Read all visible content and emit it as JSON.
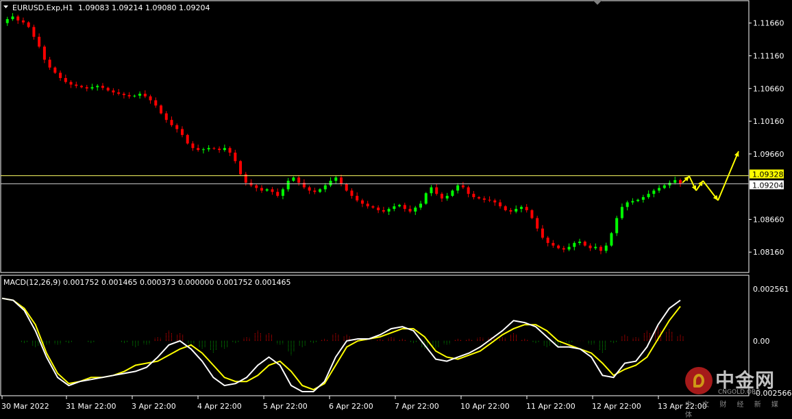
{
  "header": {
    "symbol": "EURUSD.Exp,H1",
    "ohlc": "1.09083 1.09214 1.09080 1.09204"
  },
  "macd_header": "MACD(12,26,9) 0.001752 0.001465 0.000373 0.000000 0.001752 0.001465",
  "price_axis_labels": [
    "1.11660",
    "1.11160",
    "1.10660",
    "1.10160",
    "1.09660",
    "1.08660",
    "1.08160"
  ],
  "price_badges": [
    {
      "label": "1.09328",
      "value": 1.09328,
      "bg": "#ffff00",
      "fg": "#000000"
    },
    {
      "label": "1.09204",
      "value": 1.09204,
      "bg": "#ffffff",
      "fg": "#000000"
    }
  ],
  "macd_axis_labels": [
    "0.002561",
    "0.00",
    "-0.002566"
  ],
  "time_labels": [
    "30 Mar 2022",
    "31 Mar 22:00",
    "3 Apr 22:00",
    "4 Apr 22:00",
    "5 Apr 22:00",
    "6 Apr 22:00",
    "7 Apr 22:00",
    "10 Apr 22:00",
    "11 Apr 22:00",
    "12 Apr 22:00",
    "13 Apr 22:00"
  ],
  "watermark": {
    "cn": "中金网",
    "en": "CNGOLD.ORG",
    "sub": "中 文 财 经 新 媒 体"
  },
  "colors": {
    "bull": "#00ff00",
    "bear": "#ff0000",
    "macd_main": "#ffffff",
    "macd_signal": "#ffff00",
    "hist_pos": "#ff0000",
    "hist_neg": "#00aa00",
    "forecast": "#ffff00",
    "grid_border": "#ffffff"
  },
  "chart_data": {
    "type": "line",
    "price_range": [
      1.0788,
      1.1196
    ],
    "horizontal_lines": [
      1.09328,
      1.09204
    ],
    "price_path": [
      [
        0,
        1.1166
      ],
      [
        4,
        1.1172
      ],
      [
        8,
        1.1176
      ],
      [
        12,
        1.117
      ],
      [
        16,
        1.1167
      ],
      [
        20,
        1.116
      ],
      [
        24,
        1.1145
      ],
      [
        28,
        1.113
      ],
      [
        32,
        1.111
      ],
      [
        36,
        1.1098
      ],
      [
        40,
        1.109
      ],
      [
        44,
        1.1082
      ],
      [
        48,
        1.1076
      ],
      [
        52,
        1.1072
      ],
      [
        56,
        1.107
      ],
      [
        60,
        1.1068
      ],
      [
        64,
        1.1066
      ],
      [
        68,
        1.1068
      ],
      [
        72,
        1.107
      ],
      [
        76,
        1.1067
      ],
      [
        80,
        1.1063
      ],
      [
        84,
        1.106
      ],
      [
        88,
        1.1058
      ],
      [
        92,
        1.1056
      ],
      [
        96,
        1.1054
      ],
      [
        100,
        1.1055
      ],
      [
        104,
        1.1058
      ],
      [
        108,
        1.1054
      ],
      [
        112,
        1.1048
      ],
      [
        116,
        1.104
      ],
      [
        120,
        1.1028
      ],
      [
        124,
        1.1018
      ],
      [
        128,
        1.101
      ],
      [
        132,
        1.1004
      ],
      [
        136,
        1.0995
      ],
      [
        140,
        1.0982
      ],
      [
        144,
        1.0975
      ],
      [
        148,
        1.0972
      ],
      [
        152,
        1.0973
      ],
      [
        156,
        1.0975
      ],
      [
        160,
        1.0974
      ],
      [
        164,
        1.0972
      ],
      [
        168,
        1.0975
      ],
      [
        172,
        1.0968
      ],
      [
        176,
        1.0955
      ],
      [
        180,
        1.0935
      ],
      [
        184,
        1.0922
      ],
      [
        188,
        1.0918
      ],
      [
        192,
        1.0914
      ],
      [
        196,
        1.091
      ],
      [
        200,
        1.0912
      ],
      [
        204,
        1.0908
      ],
      [
        208,
        1.0902
      ],
      [
        212,
        1.0912
      ],
      [
        216,
        1.0925
      ],
      [
        220,
        1.093
      ],
      [
        224,
        1.0922
      ],
      [
        228,
        1.0915
      ],
      [
        232,
        1.091
      ],
      [
        236,
        1.0908
      ],
      [
        240,
        1.0912
      ],
      [
        244,
        1.0918
      ],
      [
        248,
        1.0925
      ],
      [
        252,
        1.093
      ],
      [
        256,
        1.092
      ],
      [
        260,
        1.091
      ],
      [
        264,
        1.0902
      ],
      [
        268,
        1.0895
      ],
      [
        272,
        1.089
      ],
      [
        276,
        1.0886
      ],
      [
        280,
        1.0884
      ],
      [
        284,
        1.088
      ],
      [
        288,
        1.0878
      ],
      [
        292,
        1.0882
      ],
      [
        296,
        1.0886
      ],
      [
        300,
        1.0888
      ],
      [
        304,
        1.0882
      ],
      [
        308,
        1.0878
      ],
      [
        312,
        1.0884
      ],
      [
        316,
        1.089
      ],
      [
        320,
        1.0906
      ],
      [
        324,
        1.0915
      ],
      [
        328,
        1.0905
      ],
      [
        332,
        1.0898
      ],
      [
        336,
        1.0902
      ],
      [
        340,
        1.091
      ],
      [
        344,
        1.0918
      ],
      [
        348,
        1.0915
      ],
      [
        352,
        1.0905
      ],
      [
        356,
        1.09
      ],
      [
        360,
        1.0898
      ],
      [
        364,
        1.0896
      ],
      [
        368,
        1.0895
      ],
      [
        372,
        1.0892
      ],
      [
        376,
        1.0886
      ],
      [
        380,
        1.088
      ],
      [
        384,
        1.0878
      ],
      [
        388,
        1.0882
      ],
      [
        392,
        1.0885
      ],
      [
        396,
        1.088
      ],
      [
        400,
        1.0868
      ],
      [
        404,
        1.0852
      ],
      [
        408,
        1.0838
      ],
      [
        412,
        1.083
      ],
      [
        416,
        1.0826
      ],
      [
        420,
        1.0822
      ],
      [
        424,
        1.082
      ],
      [
        428,
        1.0824
      ],
      [
        432,
        1.083
      ],
      [
        436,
        1.0832
      ],
      [
        440,
        1.0826
      ],
      [
        444,
        1.0822
      ],
      [
        448,
        1.0824
      ],
      [
        452,
        1.0818
      ],
      [
        456,
        1.0826
      ],
      [
        460,
        1.0845
      ],
      [
        464,
        1.0868
      ],
      [
        468,
        1.0885
      ],
      [
        472,
        1.0892
      ],
      [
        476,
        1.0894
      ],
      [
        480,
        1.0896
      ],
      [
        484,
        1.09
      ],
      [
        488,
        1.0905
      ],
      [
        492,
        1.091
      ],
      [
        496,
        1.0914
      ],
      [
        500,
        1.0918
      ],
      [
        504,
        1.0922
      ],
      [
        508,
        1.0926
      ],
      [
        512,
        1.0921
      ]
    ],
    "forecast_path": [
      [
        1.0922,
        1.0932
      ],
      [
        1.0932,
        1.091
      ],
      [
        1.091,
        1.0925
      ],
      [
        1.0925,
        1.0895
      ],
      [
        1.0895,
        1.097
      ]
    ],
    "macd_range": [
      -0.002566,
      0.002561
    ],
    "macd_main": [
      0.0021,
      0.002,
      0.0015,
      0.0005,
      -0.0008,
      -0.0018,
      -0.0022,
      -0.002,
      -0.0019,
      -0.0018,
      -0.0017,
      -0.0016,
      -0.0015,
      -0.0013,
      -0.0008,
      -0.0002,
      0.0,
      -0.0004,
      -0.001,
      -0.0018,
      -0.0022,
      -0.0021,
      -0.0018,
      -0.0012,
      -0.0008,
      -0.0012,
      -0.0022,
      -0.0025,
      -0.0025,
      -0.002,
      -0.0008,
      0.0,
      0.0001,
      0.0001,
      0.0003,
      0.0006,
      0.0007,
      0.0005,
      -0.0002,
      -0.0009,
      -0.001,
      -0.0008,
      -0.0006,
      -0.0003,
      0.0001,
      0.0005,
      0.001,
      0.0009,
      0.0007,
      0.0002,
      -0.0003,
      -0.0003,
      -0.0004,
      -0.0008,
      -0.0017,
      -0.0018,
      -0.0011,
      -0.001,
      -0.0003,
      0.0008,
      0.0016,
      0.002
    ],
    "macd_signal": [
      0.0021,
      0.002,
      0.0016,
      0.0008,
      -0.0006,
      -0.0016,
      -0.0021,
      -0.002,
      -0.0018,
      -0.0018,
      -0.0017,
      -0.0015,
      -0.0012,
      -0.0011,
      -0.001,
      -0.0007,
      -0.0004,
      -0.0002,
      -0.0006,
      -0.0012,
      -0.0018,
      -0.002,
      -0.002,
      -0.0017,
      -0.0012,
      -0.001,
      -0.0015,
      -0.0022,
      -0.0024,
      -0.0021,
      -0.0012,
      -0.0003,
      0.0,
      0.0001,
      0.0002,
      0.0004,
      0.0006,
      0.0006,
      0.0002,
      -0.0005,
      -0.0008,
      -0.0009,
      -0.0007,
      -0.0005,
      -0.0001,
      0.0003,
      0.0006,
      0.0008,
      0.0008,
      0.0005,
      0.0,
      -0.0002,
      -0.0004,
      -0.0006,
      -0.0011,
      -0.0017,
      -0.0014,
      -0.0012,
      -0.0008,
      0.0001,
      0.001,
      0.0017
    ],
    "macd_hist": [
      0.0,
      0.0,
      -0.0001,
      -0.0003,
      -0.0002,
      -0.0002,
      -0.0001,
      0.0,
      -0.0001,
      0.0,
      0.0,
      -0.0001,
      -0.0003,
      -0.0002,
      0.0002,
      0.0005,
      0.0004,
      -0.0002,
      -0.0004,
      -0.0006,
      -0.0004,
      -0.0001,
      0.0002,
      0.0005,
      0.0004,
      -0.0002,
      -0.0007,
      -0.0003,
      -0.0001,
      0.0001,
      0.0004,
      0.0003,
      0.0001,
      0.0,
      0.0001,
      0.0002,
      0.0001,
      -0.0001,
      -0.0004,
      -0.0004,
      -0.0002,
      0.0001,
      0.0001,
      0.0002,
      0.0002,
      0.0002,
      0.0004,
      0.0001,
      -0.0001,
      -0.0003,
      -0.0003,
      -0.0001,
      0.0,
      -0.0002,
      -0.0006,
      -0.0001,
      0.0003,
      0.0002,
      0.0005,
      0.0007,
      0.0006,
      0.0003
    ]
  }
}
